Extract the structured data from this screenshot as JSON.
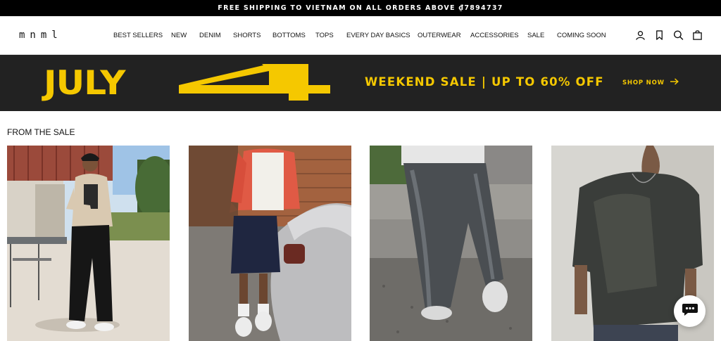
{
  "announcement": "FREE SHIPPING TO VIETNAM ON ALL ORDERS ABOVE ₫7894737",
  "brand": {
    "logo": "mnml"
  },
  "nav": {
    "items": [
      "BEST SELLERS",
      "NEW",
      "DENIM",
      "SHORTS",
      "BOTTOMS",
      "TOPS",
      "EVERY DAY BASICS",
      "OUTERWEAR",
      "ACCESSORIES",
      "SALE",
      "COMING SOON"
    ]
  },
  "header_icons": [
    "account-icon",
    "wishlist-bookmark-icon",
    "search-icon",
    "cart-bag-icon"
  ],
  "banner": {
    "headline": "JULY",
    "number_graphic": "4",
    "text": "WEEKEND SALE | UP TO 60% OFF",
    "cta": "SHOP NOW",
    "accent_color": "#f5c800",
    "background_color": "#222222"
  },
  "section": {
    "title": "FROM THE SALE"
  },
  "products": [
    {
      "image": "model-in-beige-shirt-and-black-pants"
    },
    {
      "image": "model-in-red-shirt-beside-silver-car"
    },
    {
      "image": "closeup-of-grey-baggy-jeans"
    },
    {
      "image": "model-in-faded-charcoal-tee"
    }
  ],
  "chat": {
    "icon": "chat-bubble-icon"
  }
}
